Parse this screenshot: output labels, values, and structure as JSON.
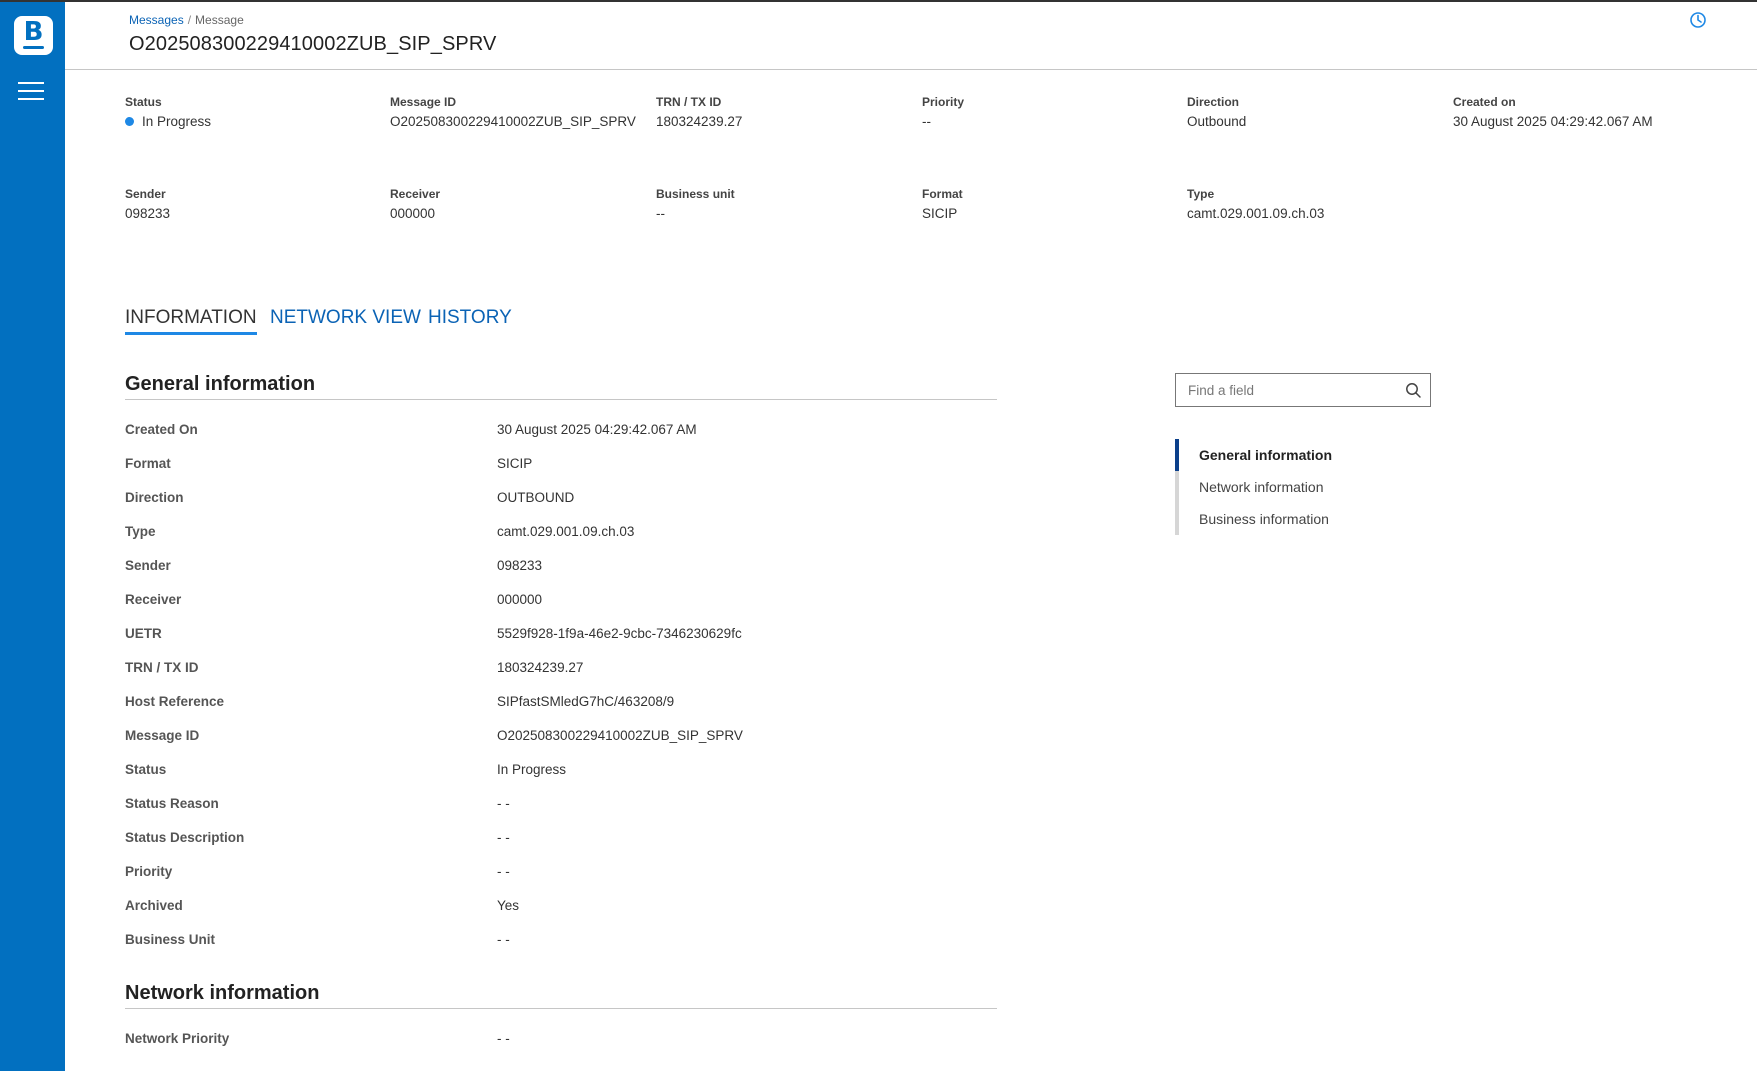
{
  "nav": {
    "logo_letter": "B",
    "menu_icon": "hamburger-menu-icon"
  },
  "header": {
    "breadcrumb": {
      "parent": "Messages",
      "separator": "/",
      "current": "Message"
    },
    "title": "O202508300229410002ZUB_SIP_SPRV",
    "history_icon": "clock-icon"
  },
  "summary": {
    "status": {
      "label": "Status",
      "value": "In Progress",
      "dot_color": "#1e88e5"
    },
    "message_id": {
      "label": "Message ID",
      "value": "O202508300229410002ZUB_SIP_SPRV"
    },
    "trn": {
      "label": "TRN / TX ID",
      "value": "180324239.27"
    },
    "priority": {
      "label": "Priority",
      "value": "--"
    },
    "direction": {
      "label": "Direction",
      "value": "Outbound"
    },
    "created_on": {
      "label": "Created on",
      "value": "30 August 2025 04:29:42.067 AM"
    },
    "sender": {
      "label": "Sender",
      "value": "098233"
    },
    "receiver": {
      "label": "Receiver",
      "value": "000000"
    },
    "business_unit": {
      "label": "Business unit",
      "value": "--"
    },
    "format": {
      "label": "Format",
      "value": "SICIP"
    },
    "type": {
      "label": "Type",
      "value": "camt.029.001.09.ch.03"
    }
  },
  "tabs": [
    {
      "label": "INFORMATION",
      "active": true
    },
    {
      "label": "NETWORK VIEW",
      "active": false
    },
    {
      "label": "HISTORY",
      "active": false
    }
  ],
  "general": {
    "title": "General information",
    "fields": [
      {
        "label": "Created On",
        "value": "30 August 2025 04:29:42.067 AM"
      },
      {
        "label": "Format",
        "value": "SICIP"
      },
      {
        "label": "Direction",
        "value": "OUTBOUND"
      },
      {
        "label": "Type",
        "value": "camt.029.001.09.ch.03"
      },
      {
        "label": "Sender",
        "value": "098233"
      },
      {
        "label": "Receiver",
        "value": "000000"
      },
      {
        "label": "UETR",
        "value": "5529f928-1f9a-46e2-9cbc-7346230629fc"
      },
      {
        "label": "TRN / TX ID",
        "value": "180324239.27"
      },
      {
        "label": "Host Reference",
        "value": "SIPfastSMledG7hC/463208/9"
      },
      {
        "label": "Message ID",
        "value": "O202508300229410002ZUB_SIP_SPRV"
      },
      {
        "label": "Status",
        "value": "In Progress"
      },
      {
        "label": "Status Reason",
        "value": "- -"
      },
      {
        "label": "Status Description",
        "value": "- -"
      },
      {
        "label": "Priority",
        "value": "- -"
      },
      {
        "label": "Archived",
        "value": "Yes"
      },
      {
        "label": "Business Unit",
        "value": "- -"
      }
    ]
  },
  "network": {
    "title": "Network information",
    "fields": [
      {
        "label": "Network Priority",
        "value": "- -"
      }
    ]
  },
  "sidepanel": {
    "search_placeholder": "Find a field",
    "search_icon": "search-icon",
    "toc": [
      {
        "label": "General information",
        "active": true
      },
      {
        "label": "Network information",
        "active": false
      },
      {
        "label": "Business information",
        "active": false
      }
    ]
  },
  "colors": {
    "sidebar": "#0270c0",
    "link": "#0b63b5",
    "tab_indicator": "#1e88e5",
    "toc_active_bar": "#0b3f8a"
  }
}
